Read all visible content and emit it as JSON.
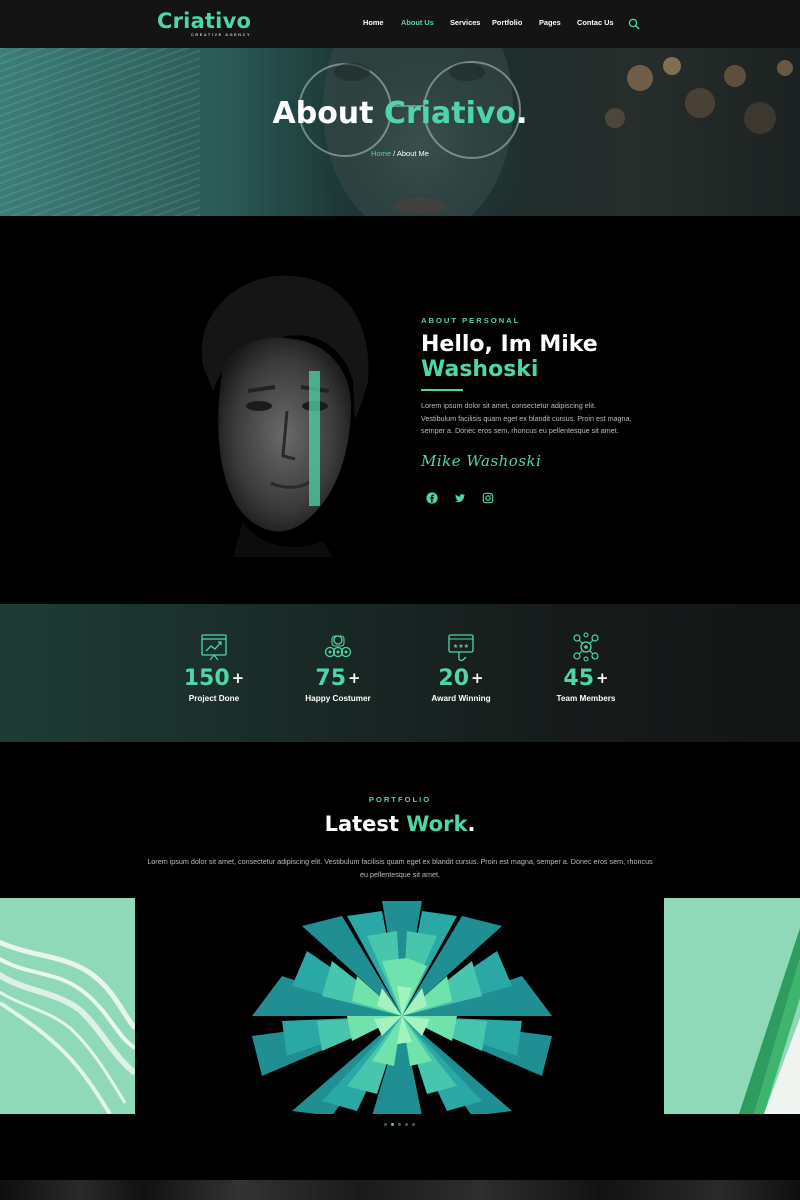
{
  "brand": {
    "name": "Criativo",
    "tagline": "CREATIVE AGENCY",
    "accent_color": "#4fd6a8"
  },
  "nav": {
    "items": [
      {
        "label": "Home",
        "active": false
      },
      {
        "label": "About Us",
        "active": true
      },
      {
        "label": "Services",
        "active": false
      },
      {
        "label": "Portfolio",
        "active": false
      },
      {
        "label": "Pages",
        "active": false
      },
      {
        "label": "Contac Us",
        "active": false
      }
    ],
    "search_icon": "search-icon"
  },
  "hero": {
    "title_main": "About ",
    "title_accent": "Criativo",
    "title_end": ".",
    "breadcrumb_home": "Home",
    "breadcrumb_sep": " / ",
    "breadcrumb_current": "About Me"
  },
  "about": {
    "eyebrow": "ABOUT PERSONAL",
    "heading_main": "Hello, Im Mike",
    "heading_accent": "Washoski",
    "text": "Lorem ipsum dolor sit amet, consectetur adipiscing elit. Vestibulum facilisis quam eget ex blandit cursus. Proin est magna, semper a. Donec eros sem, rhoncus eu pellentesque sit amet.",
    "signature": "Mike Washoski",
    "social": [
      "facebook-icon",
      "twitter-icon",
      "instagram-icon"
    ]
  },
  "stats": [
    {
      "value": "150",
      "suffix": "+",
      "label": "Project Done",
      "icon": "chart-board-icon"
    },
    {
      "value": "75",
      "suffix": "+",
      "label": "Happy Costumer",
      "icon": "customers-icon"
    },
    {
      "value": "20",
      "suffix": "+",
      "label": "Award Winning",
      "icon": "rating-screen-icon"
    },
    {
      "value": "45",
      "suffix": "+",
      "label": "Team Members",
      "icon": "team-network-icon"
    }
  ],
  "portfolio": {
    "eyebrow": "PORTFOLIO",
    "title_main": "Latest ",
    "title_accent": "Work",
    "title_end": ".",
    "description": "Lorem ipsum dolor sit amet, consectetur adipiscing elit. Vestibulum facilisis quam eget ex blandit cursus. Proin est magna, semper a. Donec eros sem, rhoncus eu pellentesque sit amet,",
    "slider_dots": 5,
    "active_dot": 1
  }
}
